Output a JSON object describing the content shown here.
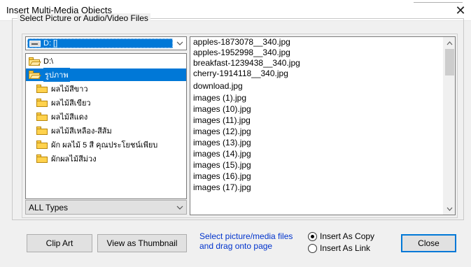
{
  "window": {
    "title": "Insert Multi-Media Objects",
    "close_glyph": "✕"
  },
  "group": {
    "label": "Select Picture or Audio/Video Files"
  },
  "drive_combo": {
    "selected": "D: []",
    "icon": "drive-icon"
  },
  "folders": [
    {
      "name": "D:\\",
      "icon": "open-folder-icon",
      "selected": false
    },
    {
      "name": "รูปภาพ",
      "icon": "open-folder-icon",
      "selected": true
    },
    {
      "name": "ผลไม้สีขาว",
      "icon": "folder-icon",
      "selected": false
    },
    {
      "name": "ผลไม้สีเขียว",
      "icon": "folder-icon",
      "selected": false
    },
    {
      "name": "ผลไม้สีแดง",
      "icon": "folder-icon",
      "selected": false
    },
    {
      "name": "ผลไม้สีเหลือง-สีส้ม",
      "icon": "folder-icon",
      "selected": false
    },
    {
      "name": "ผัก ผลไม้ 5 สี คุณประโยชน์เพียบ",
      "icon": "folder-icon",
      "selected": false
    },
    {
      "name": "ผักผลไม้สีม่วง",
      "icon": "folder-icon",
      "selected": false
    }
  ],
  "type_combo": {
    "selected": "ALL Types"
  },
  "files": [
    "apples-1873078__340.jpg",
    "apples-1952998__340.jpg",
    "breakfast-1239438__340.jpg",
    "cherry-1914118__340.jpg",
    "download.jpg",
    "images (1).jpg",
    "images (10).jpg",
    "images (11).jpg",
    "images (12).jpg",
    "images (13).jpg",
    "images (14).jpg",
    "images (15).jpg",
    "images (16).jpg",
    "images (17).jpg"
  ],
  "buttons": {
    "clip_art": "Clip Art",
    "view_thumbnail": "View as Thumbnail",
    "close": "Close"
  },
  "hint": {
    "line1": "Select picture/media files",
    "line2": "and drag onto page",
    "color": "#0033cc"
  },
  "insert_mode": {
    "options": [
      "Insert As Copy",
      "Insert As Link"
    ],
    "selected": "Insert As Copy"
  },
  "colors": {
    "selection": "#0078d7",
    "dialog_bg": "#f0f0f0"
  }
}
